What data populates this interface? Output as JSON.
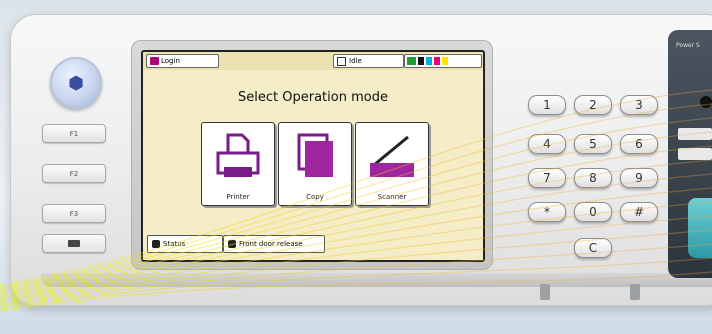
{
  "screen": {
    "login_label": "Login",
    "idle_label": "Idle",
    "title": "Select Operation mode",
    "modes": [
      {
        "label": "Printer",
        "icon": "printer-icon"
      },
      {
        "label": "Copy",
        "icon": "copy-icon"
      },
      {
        "label": "Scanner",
        "icon": "scanner-icon"
      }
    ],
    "bottom": {
      "status_label": "Status",
      "front_door_label": "Front door release"
    },
    "toner_colors": {
      "k": "#111111",
      "c": "#00a9e8",
      "m": "#e4007f",
      "y": "#ffe600"
    }
  },
  "left_panel": {
    "f1": "F1",
    "f2": "F2",
    "f3": "F3"
  },
  "keypad": {
    "keys": [
      "1",
      "2",
      "3",
      "4",
      "5",
      "6",
      "7",
      "8",
      "9",
      "*",
      "0",
      "#"
    ],
    "clear_label": "C"
  },
  "side_panel": {
    "label": "Power S"
  },
  "colors": {
    "screen_bg": "#f5ecc8",
    "accent_magenta": "#b0007a"
  }
}
